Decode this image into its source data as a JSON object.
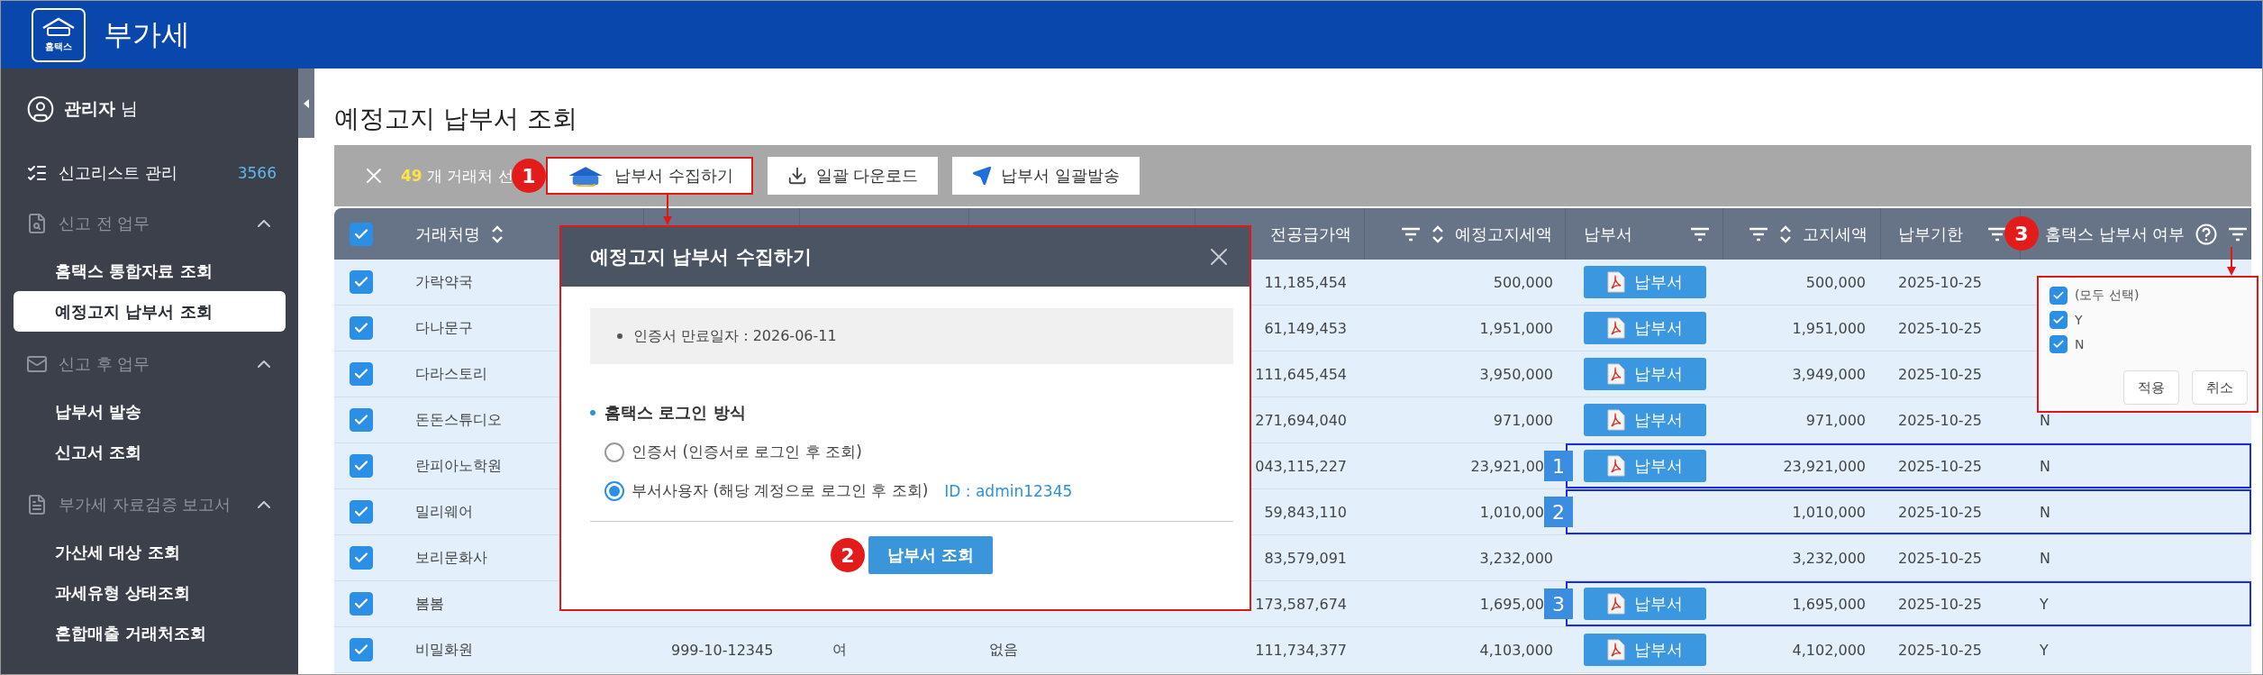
{
  "header": {
    "logo_caption": "홈택스",
    "title": "부가세"
  },
  "sidebar": {
    "user": {
      "name": "관리자",
      "suffix": "님"
    },
    "items": [
      {
        "kind": "link",
        "label": "신고리스트 관리",
        "count": "3566"
      },
      {
        "kind": "section",
        "label": "신고 전 업무",
        "expanded": true,
        "children": [
          {
            "label": "홈택스 통합자료 조회",
            "selected": false
          },
          {
            "label": "예정고지 납부서 조회",
            "selected": true
          }
        ]
      },
      {
        "kind": "section",
        "label": "신고 후 업무",
        "expanded": true,
        "children": [
          {
            "label": "납부서 발송",
            "selected": false
          },
          {
            "label": "신고서 조회",
            "selected": false
          }
        ]
      },
      {
        "kind": "section",
        "label": "부가세 자료검증 보고서",
        "expanded": true,
        "children": [
          {
            "label": "가산세 대상 조회",
            "selected": false
          },
          {
            "label": "과세유형 상태조회",
            "selected": false
          },
          {
            "label": "혼합매출 거래처조회",
            "selected": false
          }
        ]
      }
    ]
  },
  "page": {
    "title": "예정고지 납부서 조회"
  },
  "toolbar": {
    "count": "49",
    "count_label": "개 거래처 선",
    "buttons": [
      {
        "label": "납부서 수집하기",
        "highlighted": true,
        "badge": "1"
      },
      {
        "label": "일괄 다운로드",
        "highlighted": false
      },
      {
        "label": "납부서 일괄발송",
        "highlighted": false
      }
    ]
  },
  "table": {
    "all_checked": true,
    "columns": [
      {
        "label": "거래처명",
        "sortable": true,
        "filterable": false
      },
      null,
      null,
      null,
      {
        "label": "전공급가액",
        "sortable": false,
        "filterable": false
      },
      {
        "label": "예정고지세액",
        "sortable": true,
        "filterable": true
      },
      {
        "label": "납부서",
        "sortable": false,
        "filterable": true
      },
      {
        "label": "고지세액",
        "sortable": true,
        "filterable": true
      },
      {
        "label": "납부기한",
        "sortable": false,
        "filterable": true
      },
      {
        "label": "홈택스 납부서 여부",
        "sortable": false,
        "filterable": true,
        "help": true,
        "badge": "3"
      }
    ],
    "rows": [
      {
        "checked": true,
        "outlined": false,
        "cells": [
          "가락약국",
          null,
          null,
          null,
          "11,185,454",
          "500,000",
          {
            "kind": "button",
            "label": "납부서"
          },
          "500,000",
          "2025-10-25",
          null
        ]
      },
      {
        "checked": true,
        "outlined": false,
        "cells": [
          "다나문구",
          null,
          null,
          null,
          "61,149,453",
          "1,951,000",
          {
            "kind": "button",
            "label": "납부서"
          },
          "1,951,000",
          "2025-10-25",
          null
        ]
      },
      {
        "checked": true,
        "outlined": false,
        "cells": [
          "다라스토리",
          null,
          null,
          null,
          "111,645,454",
          "3,950,000",
          {
            "kind": "button",
            "label": "납부서"
          },
          "3,949,000",
          "2025-10-25",
          null
        ]
      },
      {
        "checked": true,
        "outlined": false,
        "cells": [
          "돈돈스튜디오",
          null,
          null,
          null,
          "271,694,040",
          "971,000",
          {
            "kind": "button",
            "label": "납부서"
          },
          "971,000",
          "2025-10-25",
          "N"
        ]
      },
      {
        "checked": true,
        "outlined": true,
        "marker": "1",
        "cells": [
          "란피아노학원",
          null,
          null,
          null,
          "043,115,227",
          "23,921,00",
          {
            "kind": "button",
            "label": "납부서"
          },
          "23,921,000",
          "2025-10-25",
          "N"
        ]
      },
      {
        "checked": true,
        "outlined": true,
        "marker": "2",
        "cells": [
          "밀리웨어",
          null,
          null,
          null,
          "59,843,110",
          "1,010,00",
          null,
          "1,010,000",
          "2025-10-25",
          "N"
        ]
      },
      {
        "checked": true,
        "outlined": false,
        "cells": [
          "보리문화사",
          null,
          null,
          null,
          "83,579,091",
          "3,232,000",
          null,
          "3,232,000",
          "2025-10-25",
          "N"
        ]
      },
      {
        "checked": true,
        "outlined": true,
        "marker": "3",
        "cells": [
          "봄봄",
          null,
          null,
          null,
          "173,587,674",
          "1,695,00",
          {
            "kind": "button",
            "label": "납부서"
          },
          "1,695,000",
          "2025-10-25",
          "Y"
        ]
      },
      {
        "checked": true,
        "outlined": false,
        "cells": [
          "비밀화원",
          "999-10-12345",
          "여",
          "없음",
          "111,734,377",
          "4,103,000",
          {
            "kind": "button",
            "label": "납부서"
          },
          "4,102,000",
          "2025-10-25",
          "Y"
        ]
      }
    ]
  },
  "dialog": {
    "title": "예정고지 납부서 수집하기",
    "highlighted": true,
    "info": "인증서 만료일자 : 2026-06-11",
    "section_title": "홈택스 로그인 방식",
    "options": [
      {
        "label": "인증서 (인증서로 로그인 후 조회)",
        "selected": false
      },
      {
        "label": "부서사용자 (해당 계정으로 로그인 후 조회)",
        "selected": true,
        "note": "ID : admin12345"
      }
    ],
    "button": {
      "label": "납부서 조회",
      "badge": "2"
    }
  },
  "filter_popup": {
    "highlighted": true,
    "options": [
      {
        "label": "(모두 선택)",
        "checked": true
      },
      {
        "label": "Y",
        "checked": true
      },
      {
        "label": "N",
        "checked": true
      }
    ],
    "buttons": [
      "적용",
      "취소"
    ]
  }
}
